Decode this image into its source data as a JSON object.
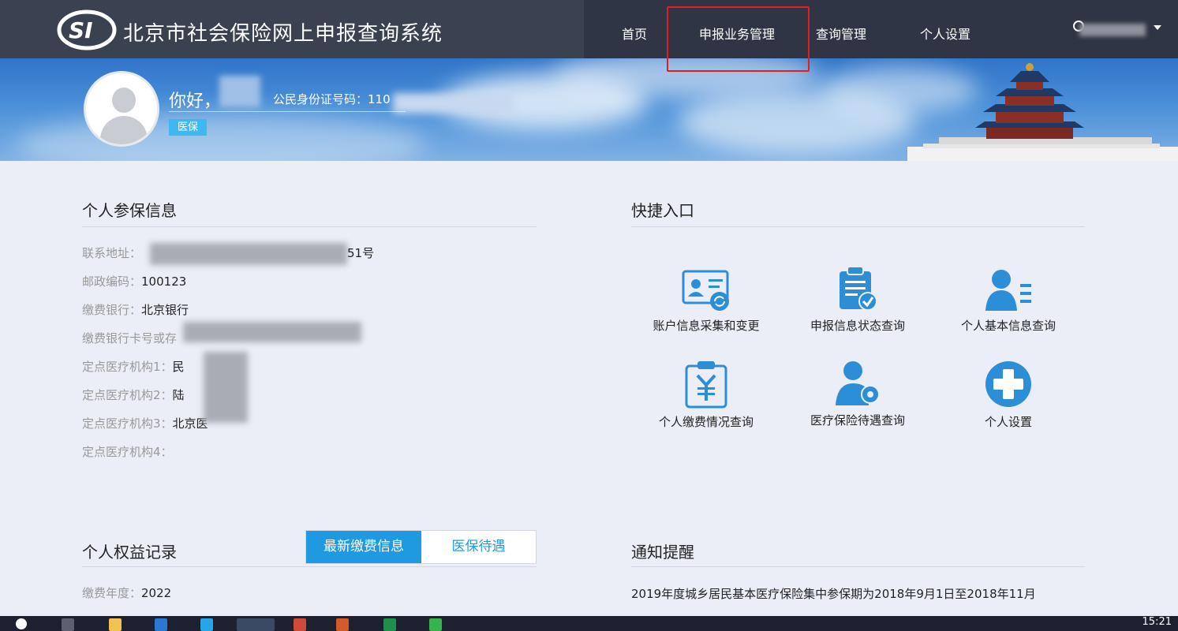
{
  "header": {
    "logo_text": "SI",
    "title": "北京市社会保险网上申报查询系统",
    "nav": [
      "首页",
      "申报业务管理",
      "查询管理",
      "个人设置"
    ]
  },
  "banner": {
    "greeting": "你好，",
    "id_label": "公民身份证号码：110",
    "badge": "医保"
  },
  "personal_info": {
    "title": "个人参保信息",
    "rows": [
      {
        "key": "联系地址：",
        "value": "51号"
      },
      {
        "key": "邮政编码：",
        "value": "100123"
      },
      {
        "key": "缴费银行：",
        "value": "北京银行"
      },
      {
        "key": "缴费银行卡号或存",
        "value": ""
      },
      {
        "key": "定点医疗机构1：",
        "value": "民"
      },
      {
        "key": "定点医疗机构2：",
        "value": "陆"
      },
      {
        "key": "定点医疗机构3：",
        "value": "北京医"
      },
      {
        "key": "定点医疗机构4：",
        "value": ""
      }
    ]
  },
  "quick_entry": {
    "title": "快捷入口",
    "items": [
      {
        "label": "账户信息采集和变更",
        "icon": "id-card-refresh-icon"
      },
      {
        "label": "申报信息状态查询",
        "icon": "clipboard-check-icon"
      },
      {
        "label": "个人基本信息查询",
        "icon": "person-list-icon"
      },
      {
        "label": "个人缴费情况查询",
        "icon": "clipboard-yen-icon"
      },
      {
        "label": "医疗保险待遇查询",
        "icon": "person-gear-icon"
      },
      {
        "label": "个人设置",
        "icon": "plus-circle-icon"
      }
    ]
  },
  "rights": {
    "title": "个人权益记录",
    "tabs": [
      "最新缴费信息",
      "医保待遇"
    ],
    "year_label": "缴费年度：",
    "year_value": "2022"
  },
  "notice": {
    "title": "通知提醒",
    "text": "2019年度城乡居民基本医疗保险集中参保期为2018年9月1日至2018年11月"
  },
  "taskbar": {
    "clock": "15:21"
  },
  "colors": {
    "nav_bg": "#3a4150",
    "accent_blue": "#1f9ae0",
    "icon_blue": "#2d8ed8",
    "highlight_red": "#e02020",
    "badge_blue": "#3db9ef"
  }
}
